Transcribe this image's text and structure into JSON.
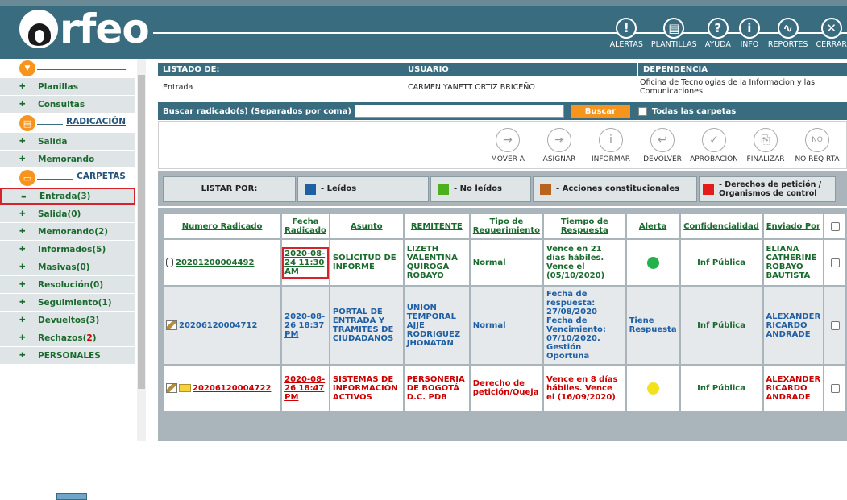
{
  "app": {
    "logo_text": "rfeo"
  },
  "topbar": {
    "items": [
      {
        "label": "ALERTAS",
        "icon": "alert-icon",
        "glyph": "!"
      },
      {
        "label": "PLANTILLAS",
        "icon": "template-icon",
        "glyph": "▤"
      },
      {
        "label": "AYUDA",
        "icon": "help-icon",
        "glyph": "?"
      },
      {
        "label": "INFO",
        "icon": "info-icon",
        "glyph": "i"
      },
      {
        "label": "REPORTES",
        "icon": "reports-icon",
        "glyph": "∿"
      },
      {
        "label": "CERRAR",
        "icon": "close-icon",
        "glyph": "✕"
      }
    ]
  },
  "sidebar": {
    "top_items": [
      "Planillas",
      "Consultas"
    ],
    "radicacion": {
      "title": "RADICACIÓN",
      "items": [
        "Salida",
        "Memorando"
      ]
    },
    "carpetas": {
      "title": "CARPETAS",
      "items": [
        {
          "label": "Entrada(3)"
        },
        {
          "label": "Salida(0)"
        },
        {
          "label": "Memorando(2)"
        },
        {
          "label": "Informados(5)"
        },
        {
          "label": "Masivas(0)"
        },
        {
          "label": "Resolución(0)"
        },
        {
          "label": "Seguimiento(1)"
        },
        {
          "label": "Devueltos(3)"
        },
        {
          "label": "Rechazos(",
          "red": "2",
          "tail": ")"
        },
        {
          "label": "PERSONALES"
        }
      ]
    }
  },
  "header": {
    "listado_label": "LISTADO DE:",
    "listado_value": "Entrada",
    "usuario_label": "USUARIO",
    "usuario_value": "CARMEN YANETT ORTIZ BRICEÑO",
    "dependencia_label": "DEPENDENCIA",
    "dependencia_value": "Oficina de Tecnologias de la Informacion y las Comunicaciones"
  },
  "search": {
    "label": "Buscar radicado(s) (Separados por coma)",
    "value": "",
    "button": "Buscar",
    "all_folders": "Todas las carpetas"
  },
  "actions": [
    "MOVER A",
    "ASIGNAR",
    "INFORMAR",
    "DEVOLVER",
    "APROBACION",
    "FINALIZAR",
    "NO REQ RTA"
  ],
  "legend": {
    "label": "LISTAR POR:",
    "items": [
      {
        "text": "- Leídos",
        "color": "#1f5fa3"
      },
      {
        "text": "- No leídos",
        "color": "#4caf1d"
      },
      {
        "text": "- Acciones constitucionales",
        "color": "#b8641f"
      },
      {
        "text": "- Derechos de petición / Organismos de control",
        "color": "#e31b1b"
      }
    ]
  },
  "table": {
    "headers": [
      "Numero Radicado",
      "Fecha Radicado",
      "Asunto",
      "REMITENTE",
      "Tipo de Requerimiento",
      "Tiempo de Respuesta",
      "Alerta",
      "Confidencialidad",
      "Enviado Por"
    ],
    "rows": [
      {
        "numero": "20201200004492",
        "fecha": "2020-08-24 11:30 AM",
        "asunto": "SOLICITUD DE INFORME",
        "remitente": "LIZETH VALENTINA QUIROGA ROBAYO",
        "tipo": "Normal",
        "tiempo": "Vence en 21 días hábiles. Vence el (05/10/2020)",
        "alerta": "",
        "alerta_color": "#22b14c",
        "confidencialidad": "Inf Pública",
        "enviado": "ELIANA CATHERINE ROBAYO BAUTISTA",
        "color": "g"
      },
      {
        "numero": "20206120004712",
        "fecha": "2020-08-26 18:37 PM",
        "asunto": "PORTAL DE ENTRADA Y TRAMITES DE CIUDADANOS",
        "remitente": "UNION TEMPORAL AJJE RODRIGUEZ JHONATAN",
        "tipo": "Normal",
        "tiempo": "Fecha de respuesta: 27/08/2020 Fecha de Vencimiento: 07/10/2020. Gestión Oportuna",
        "alerta": "Tiene Respuesta",
        "alerta_color": "",
        "confidencialidad": "Inf Pública",
        "enviado": "ALEXANDER RICARDO ANDRADE",
        "color": "b"
      },
      {
        "numero": "20206120004722",
        "fecha": "2020-08-26 18:47 PM",
        "asunto": "SISTEMAS DE INFORMACIÓN ACTIVOS",
        "remitente": "PERSONERIA DE BOGOTÁ D.C. PDB",
        "tipo": "Derecho de petición/Queja",
        "tiempo": "Vence en 8 días hábiles. Vence el (16/09/2020)",
        "alerta": "",
        "alerta_color": "#f2e11c",
        "confidencialidad": "Inf Pública",
        "enviado": "ALEXANDER RICARDO ANDRADE",
        "color": "r"
      }
    ]
  }
}
